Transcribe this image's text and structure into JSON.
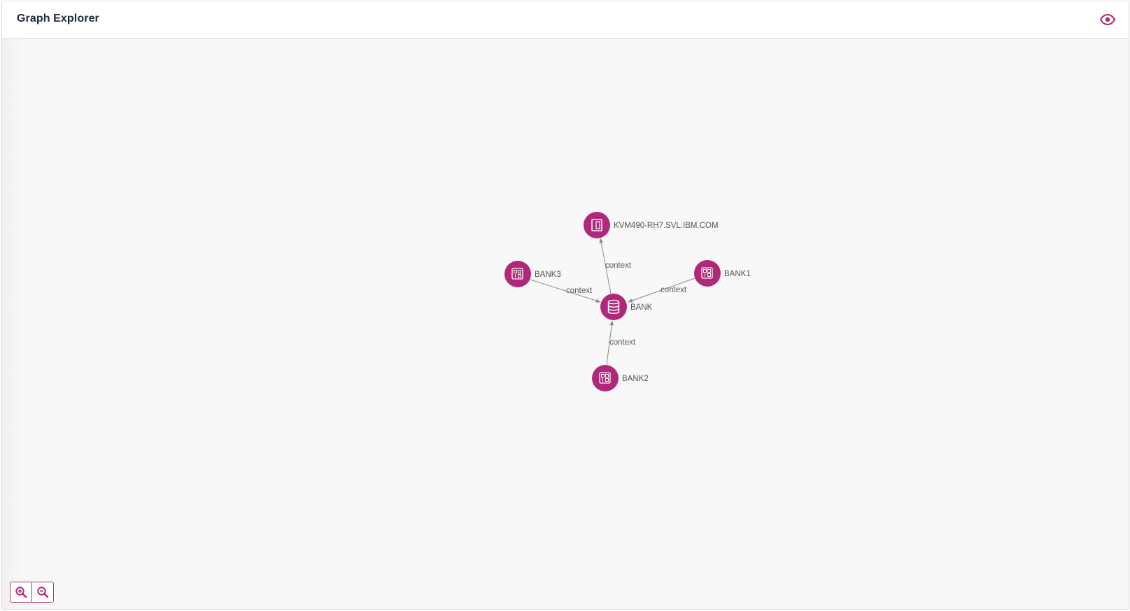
{
  "header": {
    "title": "Graph Explorer"
  },
  "theme": {
    "accent": "#b0287a",
    "edge_color": "#8a8a8a"
  },
  "graph": {
    "nodes": [
      {
        "id": "bank",
        "label": "BANK",
        "icon": "database-icon"
      },
      {
        "id": "kvm",
        "label": "KVM490-RH7.SVL.IBM.COM",
        "icon": "server-icon"
      },
      {
        "id": "bank1",
        "label": "BANK1",
        "icon": "component-icon"
      },
      {
        "id": "bank2",
        "label": "BANK2",
        "icon": "component-icon"
      },
      {
        "id": "bank3",
        "label": "BANK3",
        "icon": "component-icon"
      }
    ],
    "edges": [
      {
        "from": "bank",
        "to": "kvm",
        "label": "context"
      },
      {
        "from": "bank3",
        "to": "bank",
        "label": "context"
      },
      {
        "from": "bank1",
        "to": "bank",
        "label": "context"
      },
      {
        "from": "bank2",
        "to": "bank",
        "label": "context"
      }
    ]
  },
  "controls": {
    "zoom_in": "zoom-in-icon",
    "zoom_out": "zoom-out-icon"
  }
}
